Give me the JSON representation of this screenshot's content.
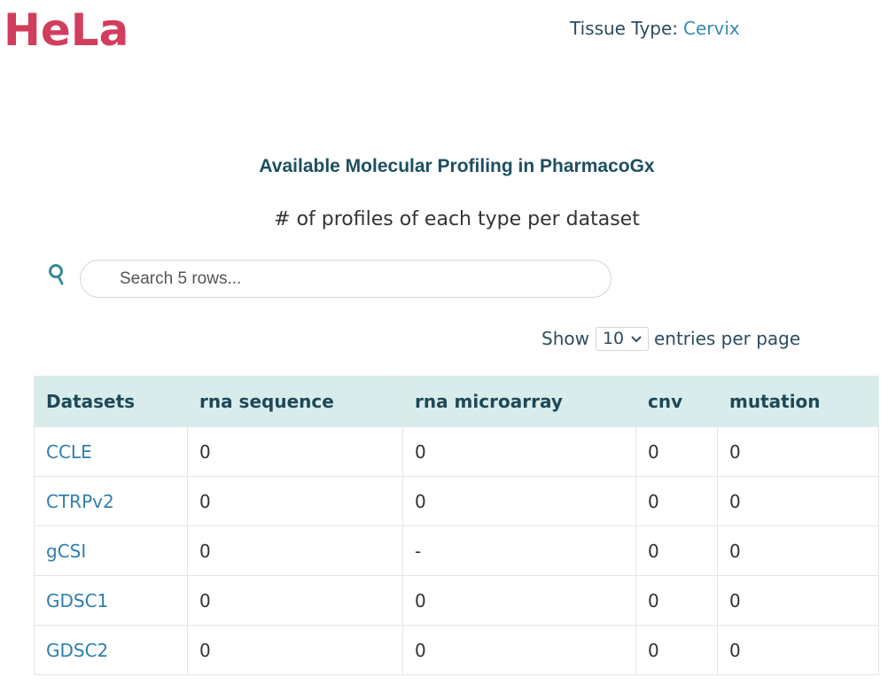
{
  "header": {
    "cell_line": "HeLa",
    "tissue_label": "Tissue Type:",
    "tissue_value": "Cervix"
  },
  "section": {
    "title": "Available Molecular Profiling in PharmacoGx",
    "subtitle": "# of profiles of each type per dataset"
  },
  "search": {
    "icon": "search-icon",
    "placeholder": "Search 5 rows..."
  },
  "entries": {
    "show_label": "Show",
    "selected": "10",
    "suffix_label": "entries per page"
  },
  "table": {
    "columns": [
      "Datasets",
      "rna sequence",
      "rna microarray",
      "cnv",
      "mutation"
    ],
    "rows": [
      [
        "CCLE",
        "0",
        "0",
        "0",
        "0"
      ],
      [
        "CTRPv2",
        "0",
        "0",
        "0",
        "0"
      ],
      [
        "gCSI",
        "0",
        "-",
        "0",
        "0"
      ],
      [
        "GDSC1",
        "0",
        "0",
        "0",
        "0"
      ],
      [
        "GDSC2",
        "0",
        "0",
        "0",
        "0"
      ]
    ]
  },
  "colors": {
    "cell_line": "#d23d5e",
    "title": "#1d4f61",
    "link": "#2f7fae",
    "header_bg": "#d9ecec"
  }
}
